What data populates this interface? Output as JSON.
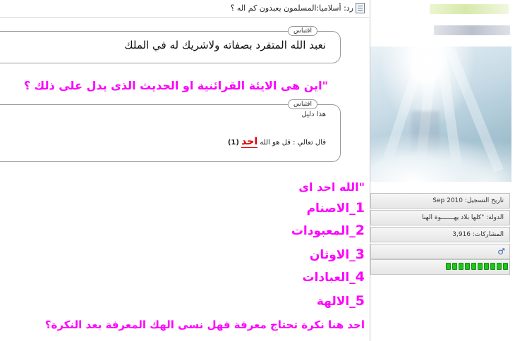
{
  "post": {
    "title": "رد: أسلاميا:المسلمون يعبدون كم اله ؟",
    "quote1": {
      "label": "اقتباس",
      "text": "نعبد الله المتفرد بصفاته ولاشريك له في الملك"
    },
    "question": "\"اين هى الايئة القرائنية او الحديث الذى يدل على ذلك ؟",
    "quote2": {
      "label": "اقتباس",
      "line1": "هذا دليل",
      "line2_prefix": "قال تعالي : قل هو الله",
      "ahad": "احد",
      "num": "(1)"
    },
    "ahad_title": "\"الله احد اى",
    "items": [
      {
        "n": "1",
        "label": "_الاصنام"
      },
      {
        "n": "2",
        "label": "_المعبودات"
      },
      {
        "n": "3",
        "label": "_الاوثان"
      },
      {
        "n": "4",
        "label": "_العبادات"
      },
      {
        "n": "5",
        "label": "_الالهة"
      }
    ],
    "closing": "احد هنا نكرة تحتاج معرفة فهل نسى الهك المعرفة بعد النكرة؟"
  },
  "user": {
    "reg_date": "تاريخ التسجيل: Sep 2010",
    "country": "الدولة: \"كلها بلاد يهـــــــوة الهنا",
    "posts": "المشاركات: 3,916",
    "gender_icon": "male-icon",
    "reputation_level": 10,
    "colors": {
      "rep": "#21c21c",
      "gender": "#2f63b5",
      "accent": "#ff00ff"
    }
  }
}
